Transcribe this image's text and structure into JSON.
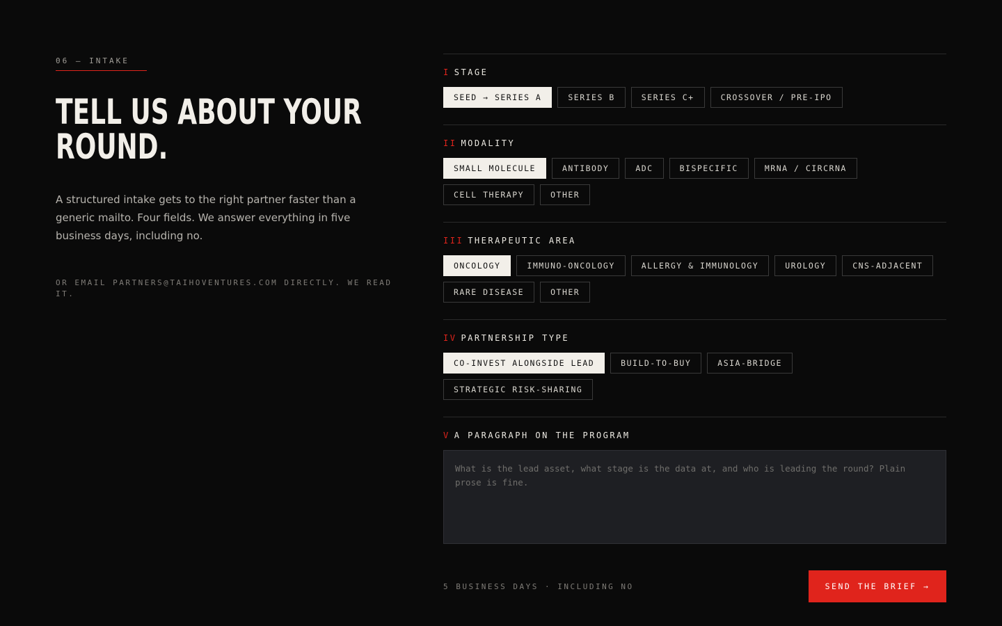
{
  "intro": {
    "eyebrow": "06 — INTAKE",
    "headline_line1": "TELL US ABOUT YOUR",
    "headline_line2": "ROUND.",
    "body": "A structured intake gets to the right partner faster than a generic mailto. Four fields. We answer everything in five business days, including no.",
    "email_note": "OR EMAIL PARTNERS@TAIHOVENTURES.COM DIRECTLY. WE READ IT."
  },
  "form": {
    "sections": [
      {
        "numeral": "I",
        "title": "STAGE",
        "options": [
          "SEED → SERIES A",
          "SERIES B",
          "SERIES C+",
          "CROSSOVER / PRE-IPO"
        ],
        "selected": "SEED → SERIES A"
      },
      {
        "numeral": "II",
        "title": "MODALITY",
        "options": [
          "SMALL MOLECULE",
          "ANTIBODY",
          "ADC",
          "BISPECIFIC",
          "MRNA / CIRCRNA",
          "CELL THERAPY",
          "OTHER"
        ],
        "selected": "SMALL MOLECULE"
      },
      {
        "numeral": "III",
        "title": "THERAPEUTIC AREA",
        "options": [
          "ONCOLOGY",
          "IMMUNO-ONCOLOGY",
          "ALLERGY & IMMUNOLOGY",
          "UROLOGY",
          "CNS-ADJACENT",
          "RARE DISEASE",
          "OTHER"
        ],
        "selected": "ONCOLOGY"
      },
      {
        "numeral": "IV",
        "title": "PARTNERSHIP TYPE",
        "options": [
          "CO-INVEST ALONGSIDE LEAD",
          "BUILD-TO-BUY",
          "ASIA-BRIDGE",
          "STRATEGIC RISK-SHARING"
        ],
        "selected": "CO-INVEST ALONGSIDE LEAD"
      }
    ],
    "paragraph": {
      "numeral": "V",
      "title": "A PARAGRAPH ON THE PROGRAM",
      "value": "",
      "placeholder": "What is the lead asset, what stage is the data at, and who is leading the round? Plain prose is fine."
    },
    "footer_note": "5 BUSINESS DAYS · INCLUDING NO",
    "submit_label": "SEND THE BRIEF →"
  },
  "colors": {
    "background": "#0a0a0a",
    "accent": "#e0241c",
    "selected_chip": "#f2efe9"
  }
}
